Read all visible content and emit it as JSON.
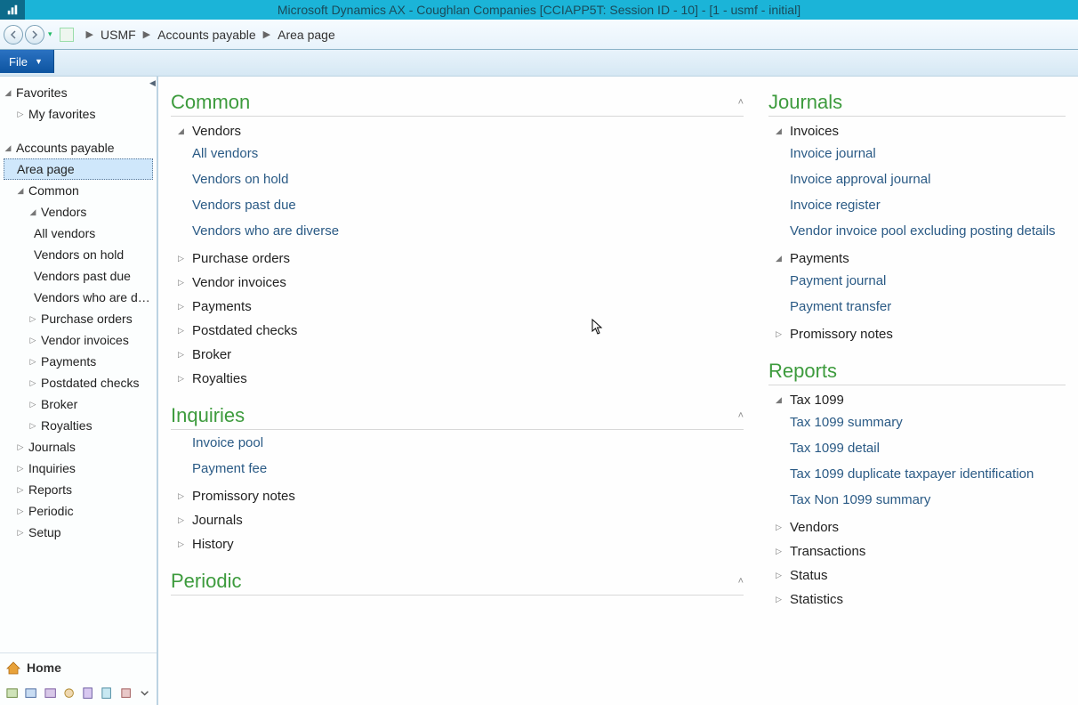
{
  "window": {
    "title": "Microsoft Dynamics AX - Coughlan Companies [CCIAPP5T: Session ID - 10]  -  [1 - usmf - initial]"
  },
  "breadcrumb": {
    "company": "USMF",
    "module": "Accounts payable",
    "page": "Area page"
  },
  "ribbon": {
    "file_label": "File"
  },
  "sidebar": {
    "favorites_label": "Favorites",
    "my_favorites_label": "My favorites",
    "module_label": "Accounts payable",
    "area_page_label": "Area page",
    "nodes": {
      "common": "Common",
      "vendors": "Vendors",
      "all_vendors": "All vendors",
      "vendors_on_hold": "Vendors on hold",
      "vendors_past_due": "Vendors past due",
      "vendors_diverse": "Vendors who are d…",
      "purchase_orders": "Purchase orders",
      "vendor_invoices": "Vendor invoices",
      "payments": "Payments",
      "postdated_checks": "Postdated checks",
      "broker": "Broker",
      "royalties": "Royalties",
      "journals": "Journals",
      "inquiries": "Inquiries",
      "reports": "Reports",
      "periodic": "Periodic",
      "setup": "Setup"
    },
    "home_label": "Home"
  },
  "content": {
    "left": {
      "common_title": "Common",
      "vendors_group": "Vendors",
      "vendors_links": {
        "all": "All vendors",
        "on_hold": "Vendors on hold",
        "past_due": "Vendors past due",
        "diverse": "Vendors who are diverse"
      },
      "purchase_orders": "Purchase orders",
      "vendor_invoices": "Vendor invoices",
      "payments": "Payments",
      "postdated_checks": "Postdated checks",
      "broker": "Broker",
      "royalties": "Royalties",
      "inquiries_title": "Inquiries",
      "inquiries_links": {
        "invoice_pool": "Invoice pool",
        "payment_fee": "Payment fee"
      },
      "promissory_notes": "Promissory notes",
      "journals": "Journals",
      "history": "History",
      "periodic_title": "Periodic"
    },
    "right": {
      "journals_title": "Journals",
      "invoices_group": "Invoices",
      "invoices_links": {
        "invoice_journal": "Invoice journal",
        "invoice_approval": "Invoice approval journal",
        "invoice_register": "Invoice register",
        "vendor_pool": "Vendor invoice pool excluding posting details"
      },
      "payments_group": "Payments",
      "payments_links": {
        "payment_journal": "Payment journal",
        "payment_transfer": "Payment transfer"
      },
      "promissory_notes": "Promissory notes",
      "reports_title": "Reports",
      "tax1099_group": "Tax 1099",
      "tax1099_links": {
        "summary": "Tax 1099 summary",
        "detail": "Tax 1099 detail",
        "dup": "Tax 1099 duplicate taxpayer identification",
        "non": "Tax Non 1099 summary"
      },
      "vendors": "Vendors",
      "transactions": "Transactions",
      "status": "Status",
      "statistics": "Statistics"
    }
  }
}
